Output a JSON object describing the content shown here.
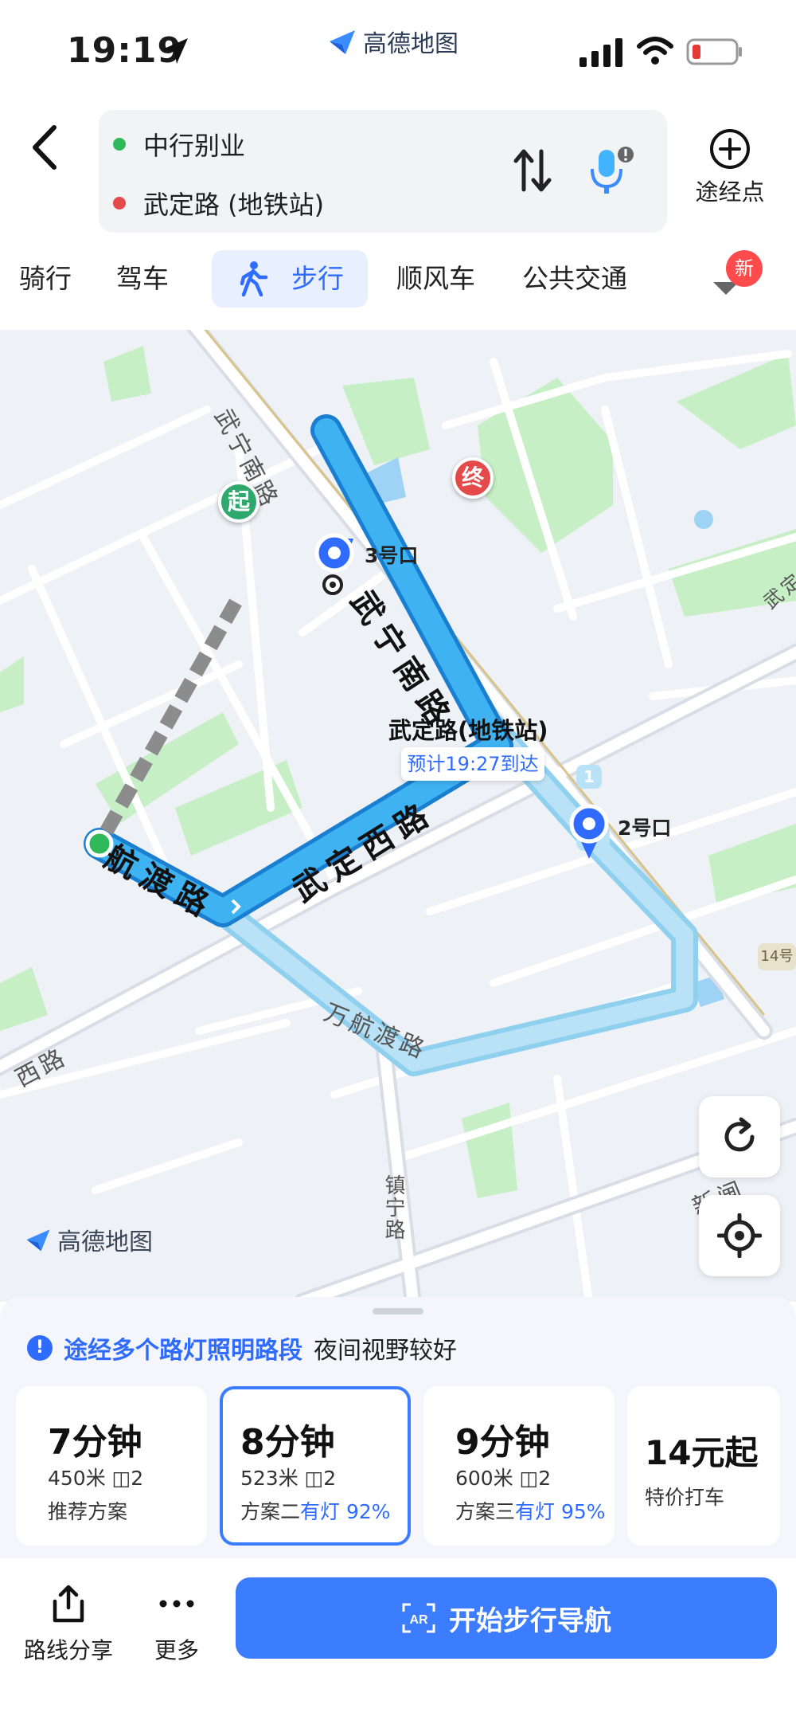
{
  "status_bar": {
    "time": "19:19"
  },
  "app": {
    "brand": "高德地图"
  },
  "route": {
    "from": "中行别业",
    "to": "武定路 (地铁站)",
    "waypoint_label": "途经点"
  },
  "tabs": [
    {
      "label": "骑行"
    },
    {
      "label": "驾车"
    },
    {
      "label": "步行"
    },
    {
      "label": "顺风车"
    },
    {
      "label": "公共交通"
    }
  ],
  "tab_more": {
    "badge": "新"
  },
  "map": {
    "roads": {
      "wuningnan": "武宁南路",
      "wudingxi": "武定西路",
      "wanhangdu_top": "航渡路",
      "wanhangdu": "万航渡路",
      "north_road": "武宁南路",
      "zhenning": "镇宁路",
      "west_road": "西路",
      "xinzha": "新闸",
      "wuding_side": "武定"
    },
    "markers": {
      "start": "起",
      "end": "终",
      "exit3": "3号口",
      "exit2": "2号口",
      "exit_num": "1",
      "line14": "14号"
    },
    "destination_name": "武定路(地铁站)",
    "eta": "预计19:27到达",
    "logo": "高德地图"
  },
  "tip": {
    "highlight": "途经多个路灯照明路段",
    "rest": "夜间视野较好"
  },
  "plans": [
    {
      "duration": "7分钟",
      "distance": "450米",
      "lights": "2",
      "desc": "推荐方案",
      "lit": ""
    },
    {
      "duration": "8分钟",
      "distance": "523米",
      "lights": "2",
      "desc": "方案二",
      "lit": "有灯 92%"
    },
    {
      "duration": "9分钟",
      "distance": "600米",
      "lights": "2",
      "desc": "方案三",
      "lit": "有灯 95%"
    },
    {
      "duration": "14元起",
      "desc": "特价打车"
    }
  ],
  "bottom": {
    "share": "路线分享",
    "more": "更多",
    "start": "开始步行导航",
    "ar": "AR"
  },
  "colors": {
    "accent": "#2f6bff",
    "route": "#3aa3e6",
    "start": "#2fb959",
    "end": "#e54a4a"
  }
}
